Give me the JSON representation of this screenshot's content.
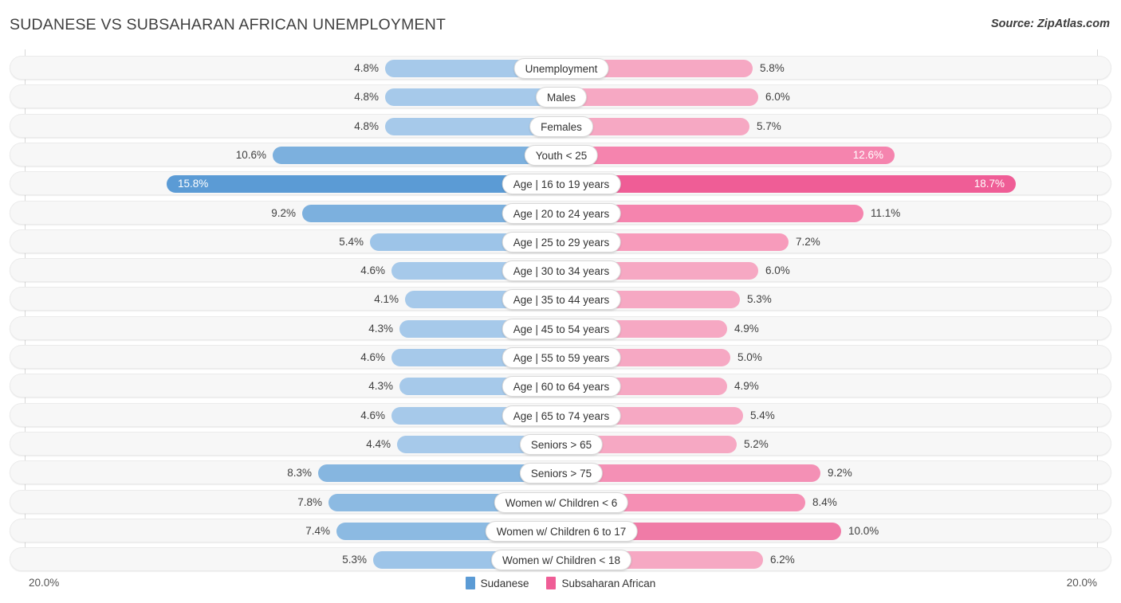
{
  "header": {
    "title": "SUDANESE VS SUBSAHARAN AFRICAN UNEMPLOYMENT",
    "source": "Source: ZipAtlas.com"
  },
  "axis": {
    "left_label": "20.0%",
    "right_label": "20.0%",
    "max": 20.0
  },
  "legend": [
    {
      "label": "Sudanese",
      "color": "#5b9bd5"
    },
    {
      "label": "Subsaharan African",
      "color": "#ef5d96"
    }
  ],
  "colors": {
    "blue_light": "#a6c9ea",
    "blue_strong": "#5b9bd5",
    "pink_light": "#f6a8c3",
    "pink_mid": "#f584ae",
    "pink_strong": "#ef5d96",
    "track": "#f7f7f7",
    "track_border": "#ebebeb"
  },
  "chart_data": {
    "type": "bar",
    "title": "SUDANESE VS SUBSAHARAN AFRICAN UNEMPLOYMENT",
    "subtitle": "",
    "xlabel": "",
    "ylabel": "",
    "orientation": "horizontal-diverging",
    "xlim": [
      20.0,
      20.0
    ],
    "grid": false,
    "legend_position": "bottom-center",
    "categories": [
      "Unemployment",
      "Males",
      "Females",
      "Youth < 25",
      "Age | 16 to 19 years",
      "Age | 20 to 24 years",
      "Age | 25 to 29 years",
      "Age | 30 to 34 years",
      "Age | 35 to 44 years",
      "Age | 45 to 54 years",
      "Age | 55 to 59 years",
      "Age | 60 to 64 years",
      "Age | 65 to 74 years",
      "Seniors > 65",
      "Seniors > 75",
      "Women w/ Children < 6",
      "Women w/ Children 6 to 17",
      "Women w/ Children < 18"
    ],
    "series": [
      {
        "name": "Sudanese",
        "values": [
          4.8,
          4.8,
          4.8,
          10.6,
          15.8,
          9.2,
          5.4,
          4.6,
          4.1,
          4.3,
          4.6,
          4.3,
          4.6,
          4.4,
          8.3,
          7.8,
          7.4,
          5.3
        ],
        "labels": [
          "4.8%",
          "4.8%",
          "4.8%",
          "10.6%",
          "15.8%",
          "9.2%",
          "5.4%",
          "4.6%",
          "4.1%",
          "4.3%",
          "4.6%",
          "4.3%",
          "4.6%",
          "4.4%",
          "8.3%",
          "7.8%",
          "7.4%",
          "5.3%"
        ]
      },
      {
        "name": "Subsaharan African",
        "values": [
          5.8,
          6.0,
          5.7,
          12.6,
          18.7,
          11.1,
          7.2,
          6.0,
          5.3,
          4.9,
          5.0,
          4.9,
          5.4,
          5.2,
          9.2,
          8.4,
          10.0,
          6.2
        ],
        "labels": [
          "5.8%",
          "6.0%",
          "5.7%",
          "12.6%",
          "18.7%",
          "11.1%",
          "7.2%",
          "6.0%",
          "5.3%",
          "4.9%",
          "5.0%",
          "4.9%",
          "5.4%",
          "5.2%",
          "9.2%",
          "8.4%",
          "10.0%",
          "6.2%"
        ]
      }
    ]
  },
  "rows": [
    {
      "label": "Unemployment",
      "left": "4.8%",
      "right": "5.8%",
      "lw": 221,
      "rw": 240,
      "lc": "#a6c9ea",
      "rc": "#f6a8c3",
      "li": false,
      "ri": false
    },
    {
      "label": "Males",
      "left": "4.8%",
      "right": "6.0%",
      "lw": 221,
      "rw": 247,
      "lc": "#a6c9ea",
      "rc": "#f6a8c3",
      "li": false,
      "ri": false
    },
    {
      "label": "Females",
      "left": "4.8%",
      "right": "5.7%",
      "lw": 221,
      "rw": 236,
      "lc": "#a6c9ea",
      "rc": "#f6a8c3",
      "li": false,
      "ri": false
    },
    {
      "label": "Youth < 25",
      "left": "10.6%",
      "right": "12.6%",
      "lw": 362,
      "rw": 418,
      "lc": "#7cb0de",
      "rc": "#f584ae",
      "li": false,
      "ri": true
    },
    {
      "label": "Age | 16 to 19 years",
      "left": "15.8%",
      "right": "18.7%",
      "lw": 495,
      "rw": 570,
      "lc": "#5b9bd5",
      "rc": "#ef5d96",
      "li": true,
      "ri": true
    },
    {
      "label": "Age | 20 to 24 years",
      "left": "9.2%",
      "right": "11.1%",
      "lw": 325,
      "rw": 379,
      "lc": "#7cb0de",
      "rc": "#f584ae",
      "li": false,
      "ri": false
    },
    {
      "label": "Age | 25 to 29 years",
      "left": "5.4%",
      "right": "7.2%",
      "lw": 240,
      "rw": 285,
      "lc": "#9dc4e8",
      "rc": "#f79bbb",
      "li": false,
      "ri": false
    },
    {
      "label": "Age | 30 to 34 years",
      "left": "4.6%",
      "right": "6.0%",
      "lw": 213,
      "rw": 247,
      "lc": "#a6c9ea",
      "rc": "#f6a8c3",
      "li": false,
      "ri": false
    },
    {
      "label": "Age | 35 to 44 years",
      "left": "4.1%",
      "right": "5.3%",
      "lw": 196,
      "rw": 224,
      "lc": "#a6c9ea",
      "rc": "#f6a8c3",
      "li": false,
      "ri": false
    },
    {
      "label": "Age | 45 to 54 years",
      "left": "4.3%",
      "right": "4.9%",
      "lw": 203,
      "rw": 208,
      "lc": "#a6c9ea",
      "rc": "#f6a8c3",
      "li": false,
      "ri": false
    },
    {
      "label": "Age | 55 to 59 years",
      "left": "4.6%",
      "right": "5.0%",
      "lw": 213,
      "rw": 212,
      "lc": "#a6c9ea",
      "rc": "#f6a8c3",
      "li": false,
      "ri": false
    },
    {
      "label": "Age | 60 to 64 years",
      "left": "4.3%",
      "right": "4.9%",
      "lw": 203,
      "rw": 208,
      "lc": "#a6c9ea",
      "rc": "#f6a8c3",
      "li": false,
      "ri": false
    },
    {
      "label": "Age | 65 to 74 years",
      "left": "4.6%",
      "right": "5.4%",
      "lw": 213,
      "rw": 228,
      "lc": "#a6c9ea",
      "rc": "#f6a8c3",
      "li": false,
      "ri": false
    },
    {
      "label": "Seniors > 65",
      "left": "4.4%",
      "right": "5.2%",
      "lw": 206,
      "rw": 220,
      "lc": "#a6c9ea",
      "rc": "#f6a8c3",
      "li": false,
      "ri": false
    },
    {
      "label": "Seniors > 75",
      "left": "8.3%",
      "right": "9.2%",
      "lw": 305,
      "rw": 325,
      "lc": "#86b6e0",
      "rc": "#f490b5",
      "li": false,
      "ri": false
    },
    {
      "label": "Women w/ Children < 6",
      "left": "7.8%",
      "right": "8.4%",
      "lw": 292,
      "rw": 306,
      "lc": "#8cbae2",
      "rc": "#f58fb4",
      "li": false,
      "ri": false
    },
    {
      "label": "Women w/ Children 6 to 17",
      "left": "7.4%",
      "right": "10.0%",
      "lw": 282,
      "rw": 351,
      "lc": "#8cbae2",
      "rc": "#f07ba7",
      "li": false,
      "ri": false
    },
    {
      "label": "Women w/ Children < 18",
      "left": "5.3%",
      "right": "6.2%",
      "lw": 236,
      "rw": 253,
      "lc": "#9dc4e8",
      "rc": "#f6a8c3",
      "li": false,
      "ri": false
    }
  ]
}
